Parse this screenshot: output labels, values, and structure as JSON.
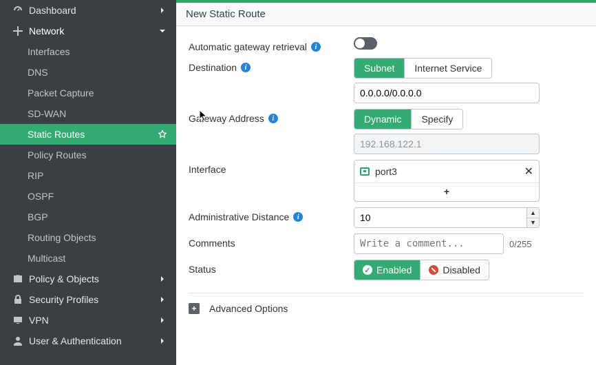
{
  "sidebar": {
    "items": [
      {
        "id": "dashboard",
        "label": "Dashboard",
        "icon": "dashboard",
        "level": 1,
        "chevron": "right"
      },
      {
        "id": "network",
        "label": "Network",
        "icon": "network",
        "level": 1,
        "chevron": "down",
        "expanded": true
      },
      {
        "id": "interfaces",
        "label": "Interfaces",
        "level": 2
      },
      {
        "id": "dns",
        "label": "DNS",
        "level": 2
      },
      {
        "id": "packet-capture",
        "label": "Packet Capture",
        "level": 2
      },
      {
        "id": "sd-wan",
        "label": "SD-WAN",
        "level": 2
      },
      {
        "id": "static-routes",
        "label": "Static Routes",
        "level": 2,
        "active": true,
        "star": true
      },
      {
        "id": "policy-routes",
        "label": "Policy Routes",
        "level": 2
      },
      {
        "id": "rip",
        "label": "RIP",
        "level": 2
      },
      {
        "id": "ospf",
        "label": "OSPF",
        "level": 2
      },
      {
        "id": "bgp",
        "label": "BGP",
        "level": 2
      },
      {
        "id": "routing-objects",
        "label": "Routing Objects",
        "level": 2
      },
      {
        "id": "multicast",
        "label": "Multicast",
        "level": 2
      },
      {
        "id": "policy-objects",
        "label": "Policy & Objects",
        "icon": "briefcase",
        "level": 1,
        "chevron": "right"
      },
      {
        "id": "security-profiles",
        "label": "Security Profiles",
        "icon": "lock",
        "level": 1,
        "chevron": "right"
      },
      {
        "id": "vpn",
        "label": "VPN",
        "icon": "monitor",
        "level": 1,
        "chevron": "right"
      },
      {
        "id": "user-auth",
        "label": "User & Authentication",
        "icon": "user",
        "level": 1,
        "chevron": "right"
      }
    ]
  },
  "page": {
    "title": "New Static Route"
  },
  "form": {
    "auto_gw_label": "Automatic gateway retrieval",
    "auto_gw_value": false,
    "destination_label": "Destination",
    "destination_mode": "Subnet",
    "destination_options": [
      "Subnet",
      "Internet Service"
    ],
    "destination_value": "0.0.0.0/0.0.0.0",
    "gateway_label": "Gateway Address",
    "gateway_mode": "Dynamic",
    "gateway_options": [
      "Dynamic",
      "Specify"
    ],
    "gateway_value": "192.168.122.1",
    "interface_label": "Interface",
    "interface_selected": "port3",
    "admin_distance_label": "Administrative Distance",
    "admin_distance_value": "10",
    "comments_label": "Comments",
    "comments_placeholder": "Write a comment...",
    "comments_counter": "0/255",
    "status_label": "Status",
    "status_value": "Enabled",
    "status_options": [
      "Enabled",
      "Disabled"
    ],
    "advanced_label": "Advanced Options"
  },
  "colors": {
    "accent": "#34ab72",
    "sidebar": "#3a3f43"
  }
}
